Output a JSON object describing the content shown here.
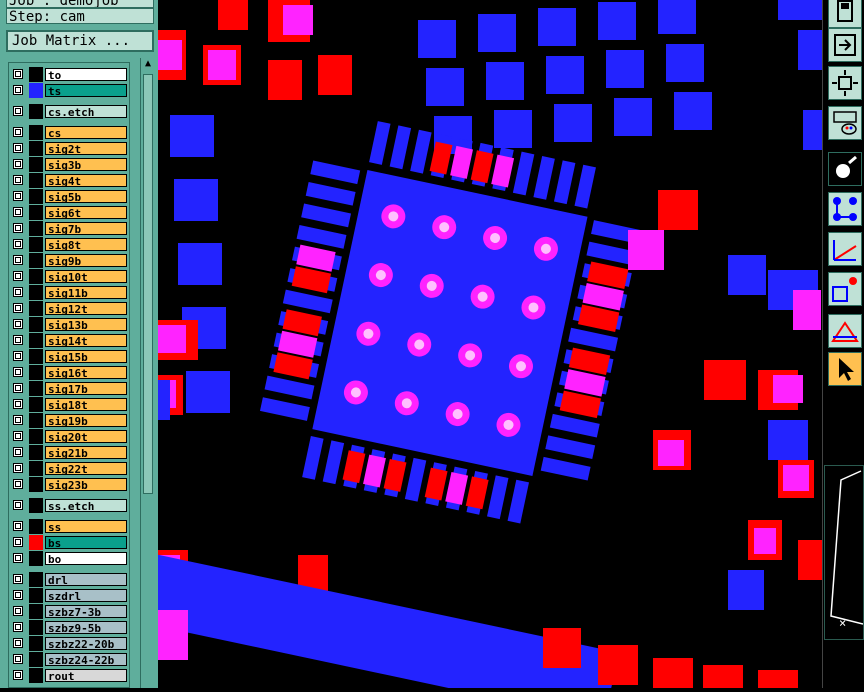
{
  "header": {
    "title_cut": "Job : demojob",
    "step_label": "Step: cam",
    "job_matrix_label": "Job Matrix ..."
  },
  "colors": {
    "panel_bg": "#5fae9c",
    "signal_layer": "#ffc050",
    "drill_layer": "#a8c0c8",
    "active_layer": "#0aa08c",
    "canvas_red": "#ff0000",
    "canvas_blue": "#2323ff",
    "canvas_magenta": "#ff23ff"
  },
  "layers": [
    {
      "name": "to",
      "swatch": "#000000",
      "bg": "#ffffff"
    },
    {
      "name": "ts",
      "swatch": "#2323ff",
      "bg": "#0aa08c"
    },
    {
      "name": "cs.etch",
      "swatch": "#000000",
      "bg": "#bfe1d6",
      "gap_before": true
    },
    {
      "name": "cs",
      "swatch": "#000000",
      "bg": "#ffc050",
      "gap_before": true
    },
    {
      "name": "sig2t",
      "swatch": "#000000",
      "bg": "#ffc050"
    },
    {
      "name": "sig3b",
      "swatch": "#000000",
      "bg": "#ffc050"
    },
    {
      "name": "sig4t",
      "swatch": "#000000",
      "bg": "#ffc050"
    },
    {
      "name": "sig5b",
      "swatch": "#000000",
      "bg": "#ffc050"
    },
    {
      "name": "sig6t",
      "swatch": "#000000",
      "bg": "#ffc050"
    },
    {
      "name": "sig7b",
      "swatch": "#000000",
      "bg": "#ffc050"
    },
    {
      "name": "sig8t",
      "swatch": "#000000",
      "bg": "#ffc050"
    },
    {
      "name": "sig9b",
      "swatch": "#000000",
      "bg": "#ffc050"
    },
    {
      "name": "sig10t",
      "swatch": "#000000",
      "bg": "#ffc050"
    },
    {
      "name": "sig11b",
      "swatch": "#000000",
      "bg": "#ffc050"
    },
    {
      "name": "sig12t",
      "swatch": "#000000",
      "bg": "#ffc050"
    },
    {
      "name": "sig13b",
      "swatch": "#000000",
      "bg": "#ffc050"
    },
    {
      "name": "sig14t",
      "swatch": "#000000",
      "bg": "#ffc050"
    },
    {
      "name": "sig15b",
      "swatch": "#000000",
      "bg": "#ffc050"
    },
    {
      "name": "sig16t",
      "swatch": "#000000",
      "bg": "#ffc050"
    },
    {
      "name": "sig17b",
      "swatch": "#000000",
      "bg": "#ffc050"
    },
    {
      "name": "sig18t",
      "swatch": "#000000",
      "bg": "#ffc050"
    },
    {
      "name": "sig19b",
      "swatch": "#000000",
      "bg": "#ffc050"
    },
    {
      "name": "sig20t",
      "swatch": "#000000",
      "bg": "#ffc050"
    },
    {
      "name": "sig21b",
      "swatch": "#000000",
      "bg": "#ffc050"
    },
    {
      "name": "sig22t",
      "swatch": "#000000",
      "bg": "#ffc050"
    },
    {
      "name": "sig23b",
      "swatch": "#000000",
      "bg": "#ffc050"
    },
    {
      "name": "ss.etch",
      "swatch": "#000000",
      "bg": "#bfe1d6",
      "gap_before": true
    },
    {
      "name": "ss",
      "swatch": "#000000",
      "bg": "#ffc050",
      "gap_before": true
    },
    {
      "name": "bs",
      "swatch": "#ff0000",
      "bg": "#0aa08c"
    },
    {
      "name": "bo",
      "swatch": "#000000",
      "bg": "#ffffff"
    },
    {
      "name": "drl",
      "swatch": "#000000",
      "bg": "#a8c0c8",
      "gap_before": true
    },
    {
      "name": "szdrl",
      "swatch": "#000000",
      "bg": "#a8c0c8"
    },
    {
      "name": "szbz7-3b",
      "swatch": "#000000",
      "bg": "#a8c0c8"
    },
    {
      "name": "szbz9-5b",
      "swatch": "#000000",
      "bg": "#a8c0c8"
    },
    {
      "name": "szbz22-20b",
      "swatch": "#000000",
      "bg": "#a8c0c8"
    },
    {
      "name": "szbz24-22b",
      "swatch": "#000000",
      "bg": "#a8c0c8"
    },
    {
      "name": "rout",
      "swatch": "#000000",
      "bg": "#d8d8d8"
    }
  ],
  "toolbar": [
    {
      "name": "save-icon"
    },
    {
      "name": "import-icon"
    },
    {
      "name": "zoom-fit-icon"
    },
    {
      "name": "tools-palette-icon"
    },
    {
      "name": "graphic-editor-icon"
    },
    {
      "name": "netlist-icon"
    },
    {
      "name": "measure-icon"
    },
    {
      "name": "align-icon"
    },
    {
      "name": "dfm-icon"
    },
    {
      "name": "select-pointer-icon"
    }
  ],
  "minimap": {
    "close_glyph": "×"
  }
}
